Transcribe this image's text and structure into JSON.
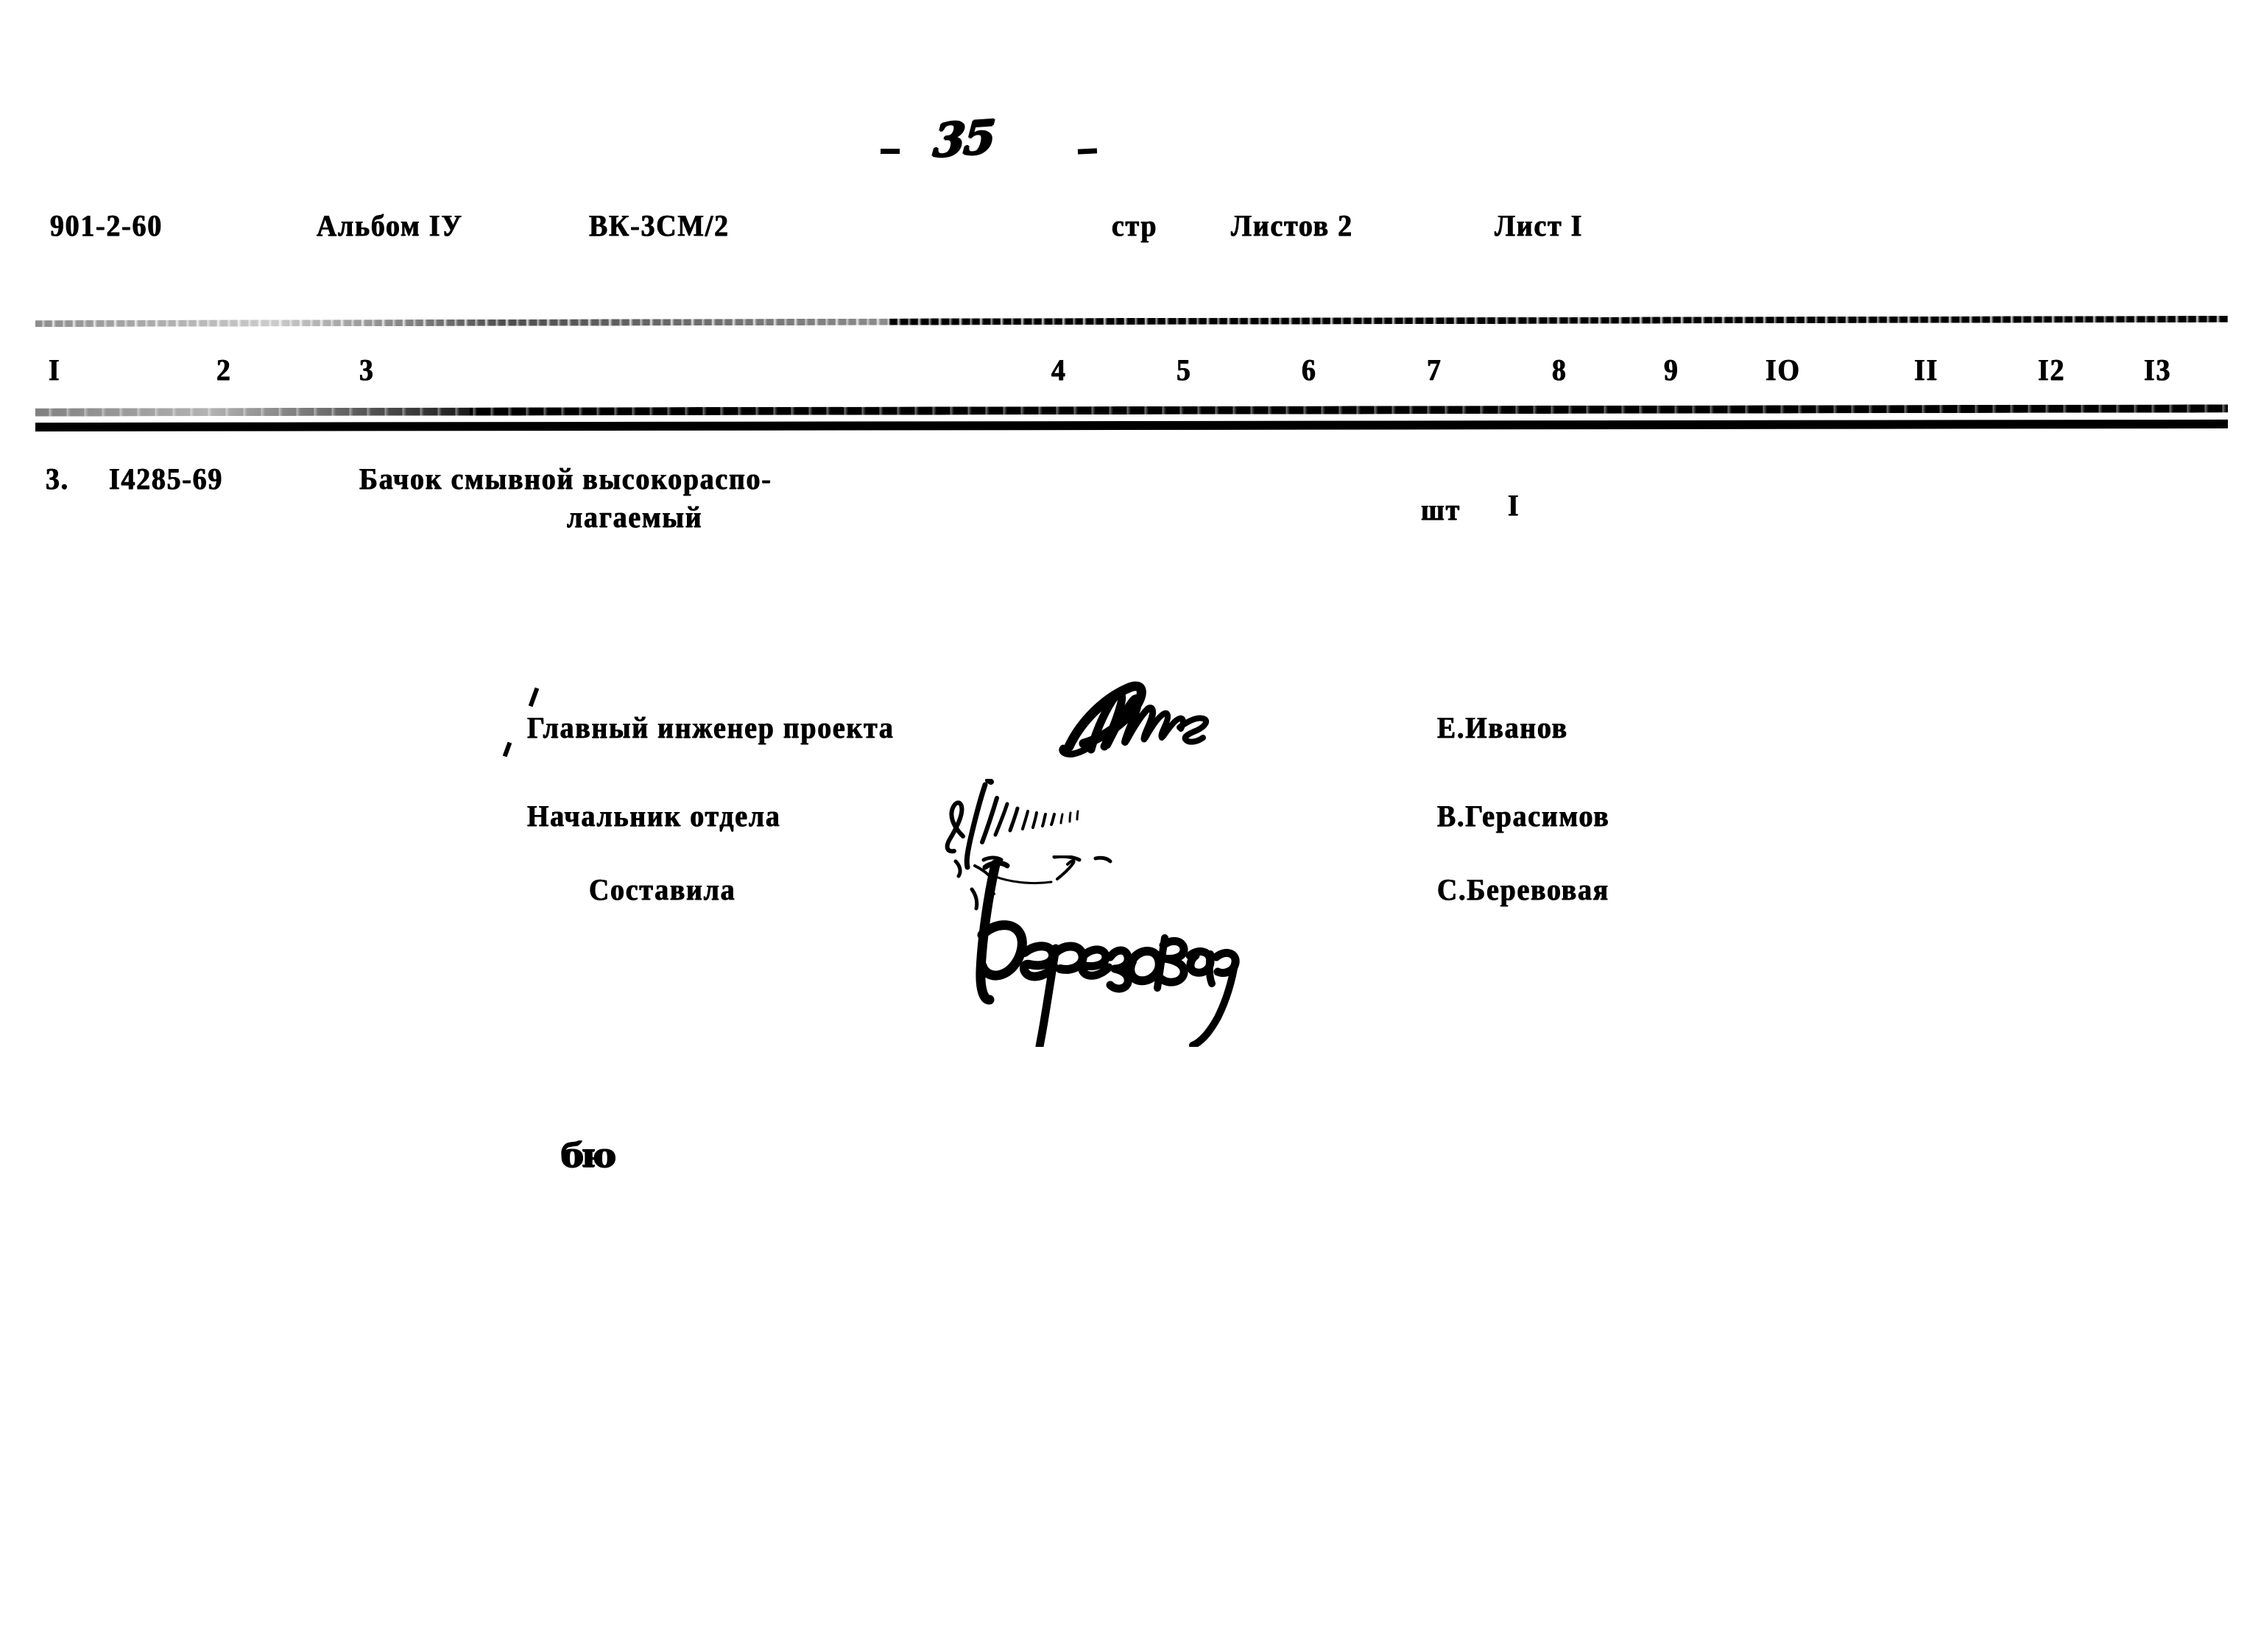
{
  "document": {
    "page_number": "35",
    "page_number_prefix": "-",
    "page_number_suffix": "-",
    "bottom_mark": "бю"
  },
  "header": {
    "project_code": "901-2-60",
    "album": "Альбом IУ",
    "section": "ВК-3СМ/2",
    "page_label": "стр",
    "sheets_total": "Листов 2",
    "sheet_current": "Лист I"
  },
  "table": {
    "column_headers": [
      "I",
      "2",
      "3",
      "4",
      "5",
      "6",
      "7",
      "8",
      "9",
      "IO",
      "II",
      "I2",
      "I3"
    ],
    "rows": [
      {
        "item_no": "3.",
        "code": "I4285-69",
        "name_line1": "Бачок смывной высокораспо-",
        "name_line2": "лагаемый",
        "unit": "шт",
        "quantity": "I"
      }
    ]
  },
  "signatures": [
    {
      "role": "Главный инженер проекта",
      "name": "Е.Иванов",
      "signature": "signature-scrawl-engineer"
    },
    {
      "role": "Начальник отдела",
      "name": "В.Герасимов",
      "signature": "signature-scrawl-head"
    },
    {
      "role": "Составила",
      "name": "С.Беревовая",
      "signature": "signature-berezovaya"
    }
  ],
  "colors": {
    "ink": "#000000",
    "paper": "#ffffff"
  }
}
